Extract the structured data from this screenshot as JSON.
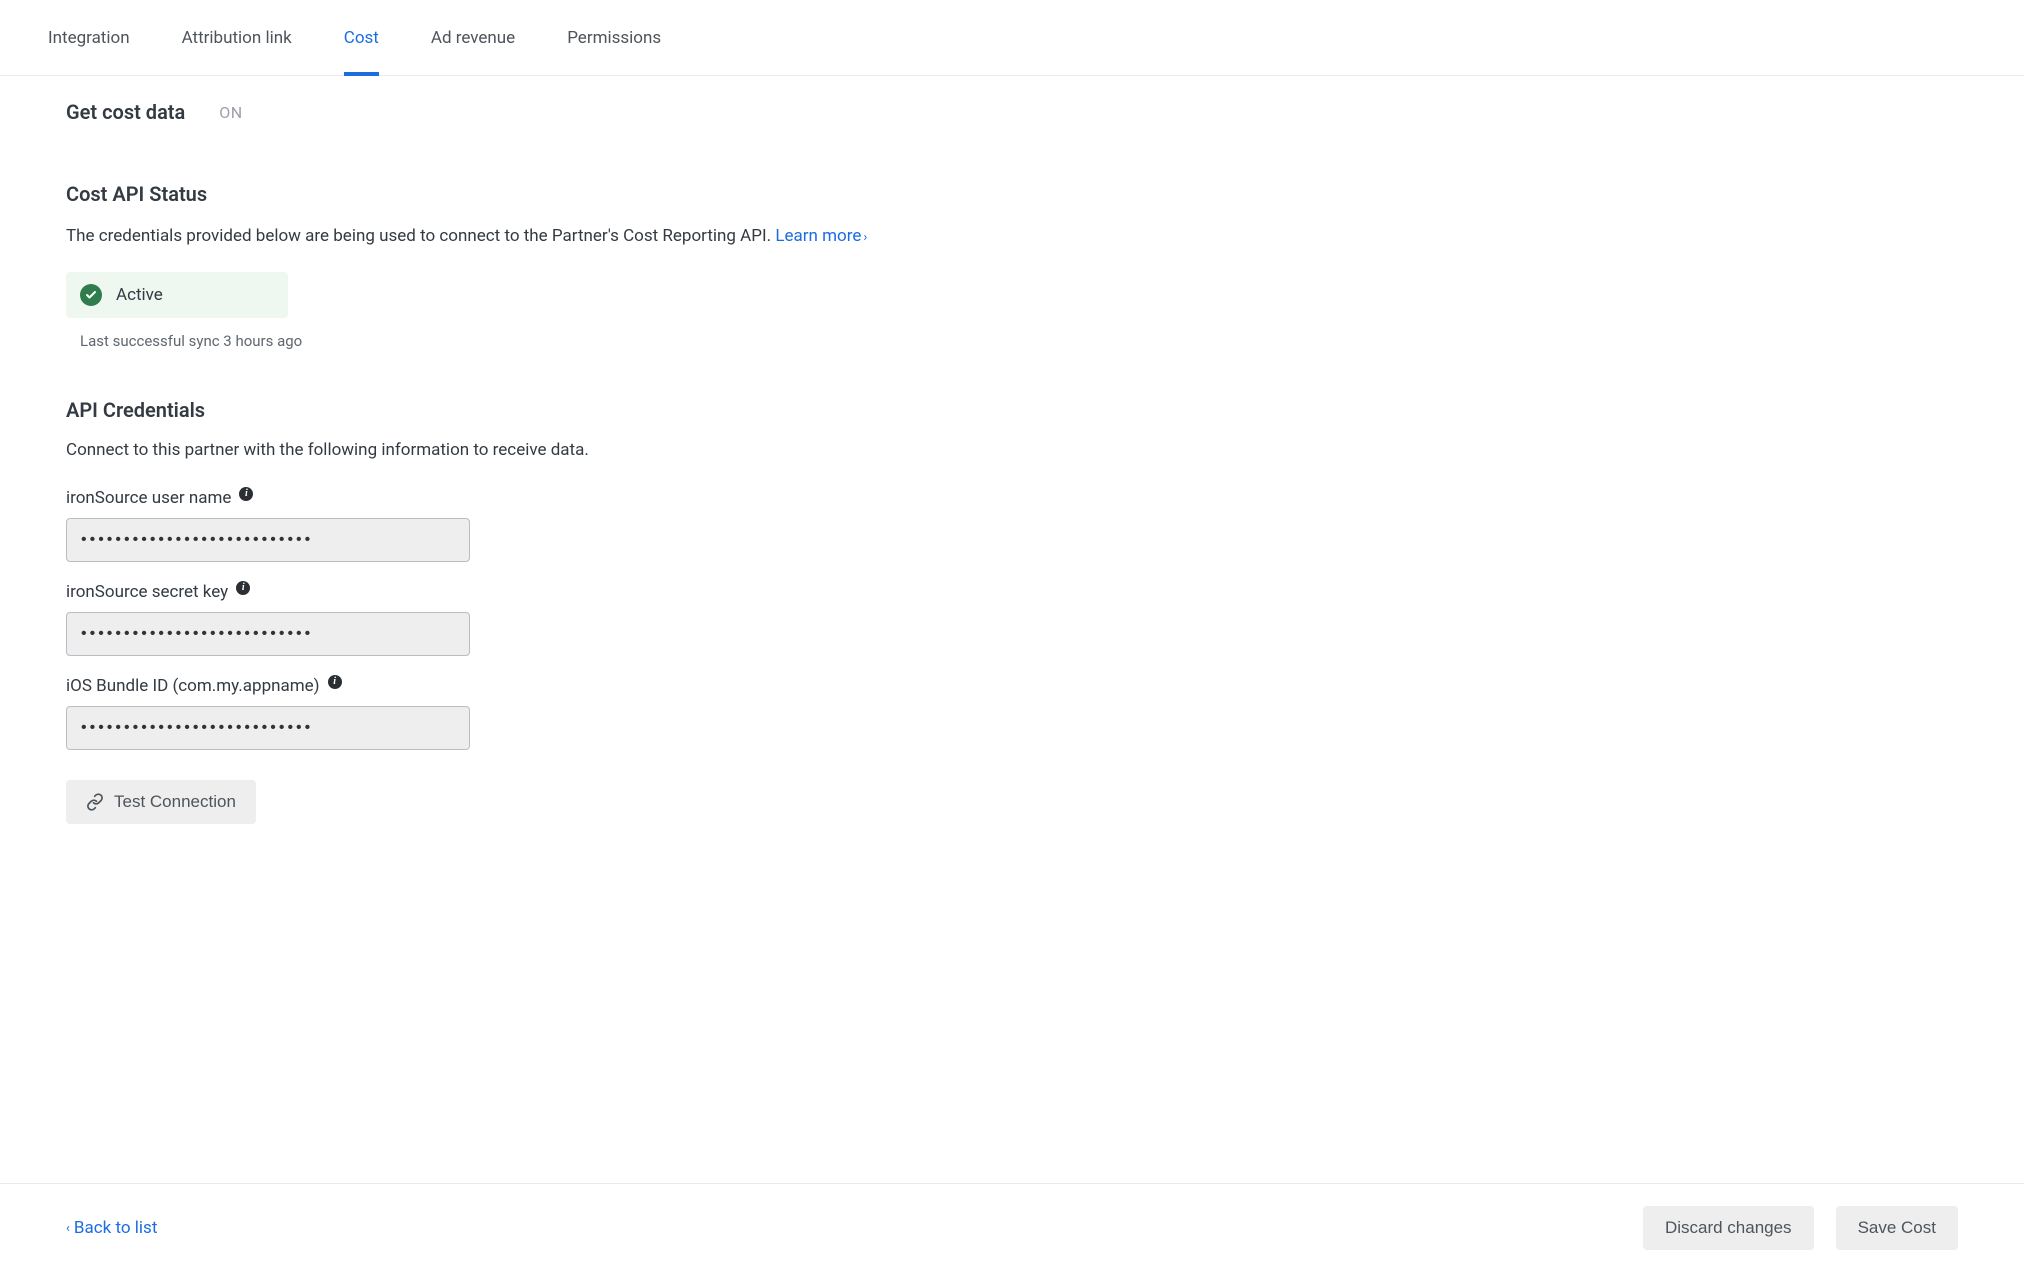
{
  "tabs": {
    "integration": "Integration",
    "attribution_link": "Attribution link",
    "cost": "Cost",
    "ad_revenue": "Ad revenue",
    "permissions": "Permissions"
  },
  "header": {
    "title": "Get cost data",
    "toggle_state": "ON"
  },
  "status": {
    "section_title": "Cost API Status",
    "description": "The credentials provided below are being used to connect to the Partner's Cost Reporting API. ",
    "learn_more": "Learn more",
    "badge_text": "Active",
    "sync_text": "Last successful sync 3 hours ago"
  },
  "credentials": {
    "section_title": "API Credentials",
    "description": "Connect to this partner with the following information to receive data.",
    "fields": {
      "username": {
        "label": "ironSource user name",
        "value": "•••••••••••••••••••••••••••"
      },
      "secret": {
        "label": "ironSource secret key",
        "value": "•••••••••••••••••••••••••••"
      },
      "bundle": {
        "label": "iOS Bundle ID (com.my.appname)",
        "value": "•••••••••••••••••••••••••••"
      }
    },
    "test_connection": "Test Connection"
  },
  "footer": {
    "back": "Back to list",
    "discard": "Discard changes",
    "save": "Save Cost"
  }
}
